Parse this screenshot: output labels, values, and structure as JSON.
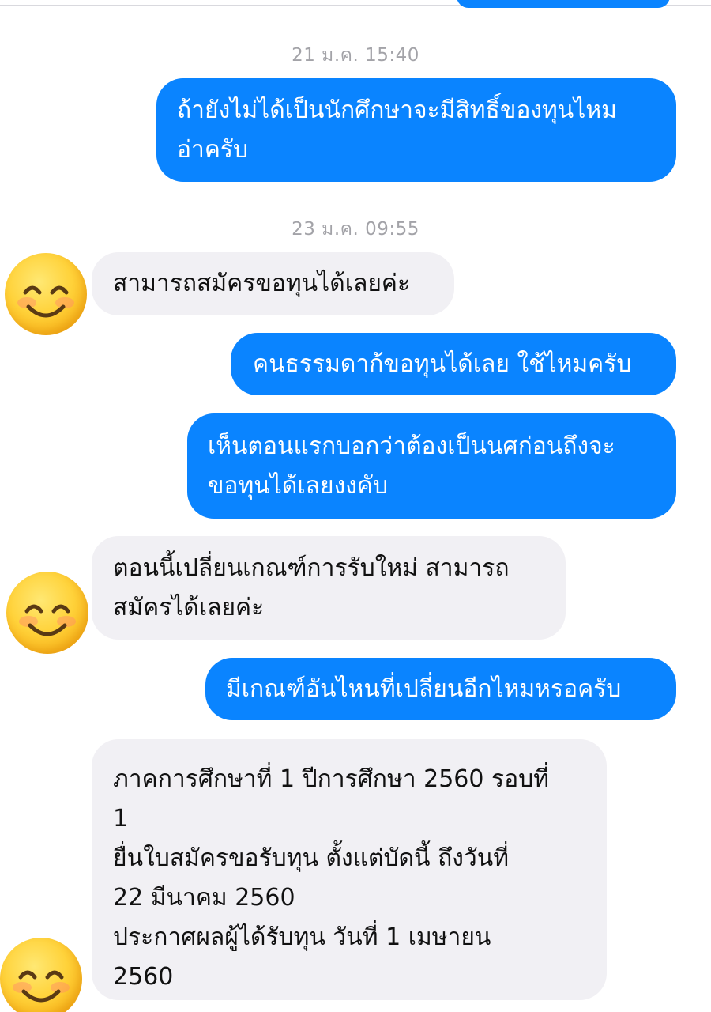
{
  "messages": {
    "ts1": "21 ม.ค. 15:40",
    "m1": [
      "ถ้ายังไม่ได้เป็นนักศึกษาจะมีสิทธิ์ของทุนไหม",
      "อ่าครับ"
    ],
    "ts2": "23 ม.ค. 09:55",
    "m2": [
      "สามารถสมัครขอทุนได้เลยค่ะ"
    ],
    "m3": [
      "คนธรรมดาก้ขอทุนได้เลย ใช้ไหมครับ"
    ],
    "m4": [
      "เห็นตอนแรกบอกว่าต้องเป็นนศก่อนถึงจะ",
      "ขอทุนได้เลยงงคับ"
    ],
    "m5": [
      "ตอนนี้เปลี่ยนเกณฑ์การรับใหม่ สามารถ",
      "สมัครได้เลยค่ะ"
    ],
    "m6": [
      "มีเกณฑ์อันไหนที่เปลี่ยนอีกไหมหรอครับ"
    ],
    "m7": [
      "ภาคการศึกษาที่ 1 ปีการศึกษา 2560 รอบที่",
      "1",
      "ยื่นใบสมัครขอรับทุน  ตั้งแต่บัดนี้ ถึงวันที่",
      "22 มีนาคม 2560",
      "ประกาศผลผู้ได้รับทุน  วันที่ 1 เมษายน",
      "2560"
    ]
  },
  "icons": {
    "avatar": "smiling-face-emoji-icon"
  },
  "colors": {
    "outgoing": "#0a84ff",
    "incoming": "#f1f0f4",
    "timestamp": "#a3a3a8"
  }
}
